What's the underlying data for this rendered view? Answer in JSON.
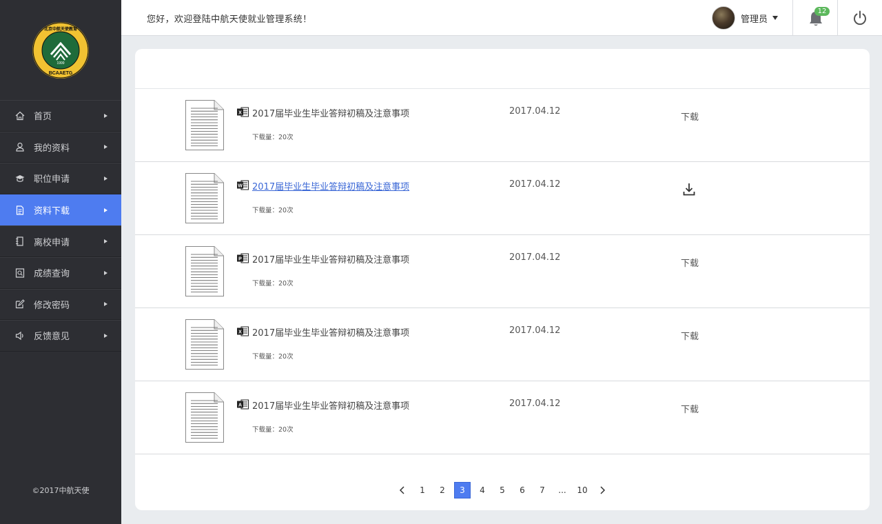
{
  "sidebar": {
    "logo": {
      "circle_text_top": "北京中航天使教育科技集团",
      "center_text": "1999",
      "bottom_text": "BCAAETG"
    },
    "items": [
      {
        "label": "首页",
        "icon": "home-icon",
        "active": false
      },
      {
        "label": "我的资料",
        "icon": "user-icon",
        "active": false
      },
      {
        "label": "职位申请",
        "icon": "graduation-cap-icon",
        "active": false
      },
      {
        "label": "资料下载",
        "icon": "document-icon",
        "active": true
      },
      {
        "label": "离校申请",
        "icon": "form-icon",
        "active": false
      },
      {
        "label": "成绩查询",
        "icon": "search-doc-icon",
        "active": false
      },
      {
        "label": "修改密码",
        "icon": "edit-icon",
        "active": false
      },
      {
        "label": "反馈意见",
        "icon": "speaker-icon",
        "active": false
      }
    ],
    "footer": "©2017中航天使"
  },
  "header": {
    "welcome": "您好，欢迎登陆中航天使就业管理系统！",
    "user_name": "管理员",
    "notification_count": "12"
  },
  "files": [
    {
      "title": "2017届毕业生毕业答辩初稿及注意事项",
      "type": "excel",
      "date": "2017.04.12",
      "downloads": "下载量：20次",
      "action": "下载",
      "hover": false
    },
    {
      "title": "2017届毕业生毕业答辩初稿及注意事项",
      "type": "word",
      "date": "2017.04.12",
      "downloads": "下载量：20次",
      "action": "下载",
      "hover": true
    },
    {
      "title": "2017届毕业生毕业答辩初稿及注意事项",
      "type": "ppt",
      "date": "2017.04.12",
      "downloads": "下载量：20次",
      "action": "下载",
      "hover": false
    },
    {
      "title": "2017届毕业生毕业答辩初稿及注意事项",
      "type": "excel",
      "date": "2017.04.12",
      "downloads": "下载量：20次",
      "action": "下载",
      "hover": false
    },
    {
      "title": "2017届毕业生毕业答辩初稿及注意事项",
      "type": "pdf",
      "date": "2017.04.12",
      "downloads": "下载量：20次",
      "action": "下载",
      "hover": false
    }
  ],
  "pagination": {
    "pages": [
      "1",
      "2",
      "3",
      "4",
      "5",
      "6",
      "7",
      "...",
      "10"
    ],
    "current": "3"
  },
  "colors": {
    "accent": "#4e7cf0",
    "sidebar_bg": "#2d2e33",
    "badge": "#5cb85c",
    "link": "#3a67d6"
  }
}
